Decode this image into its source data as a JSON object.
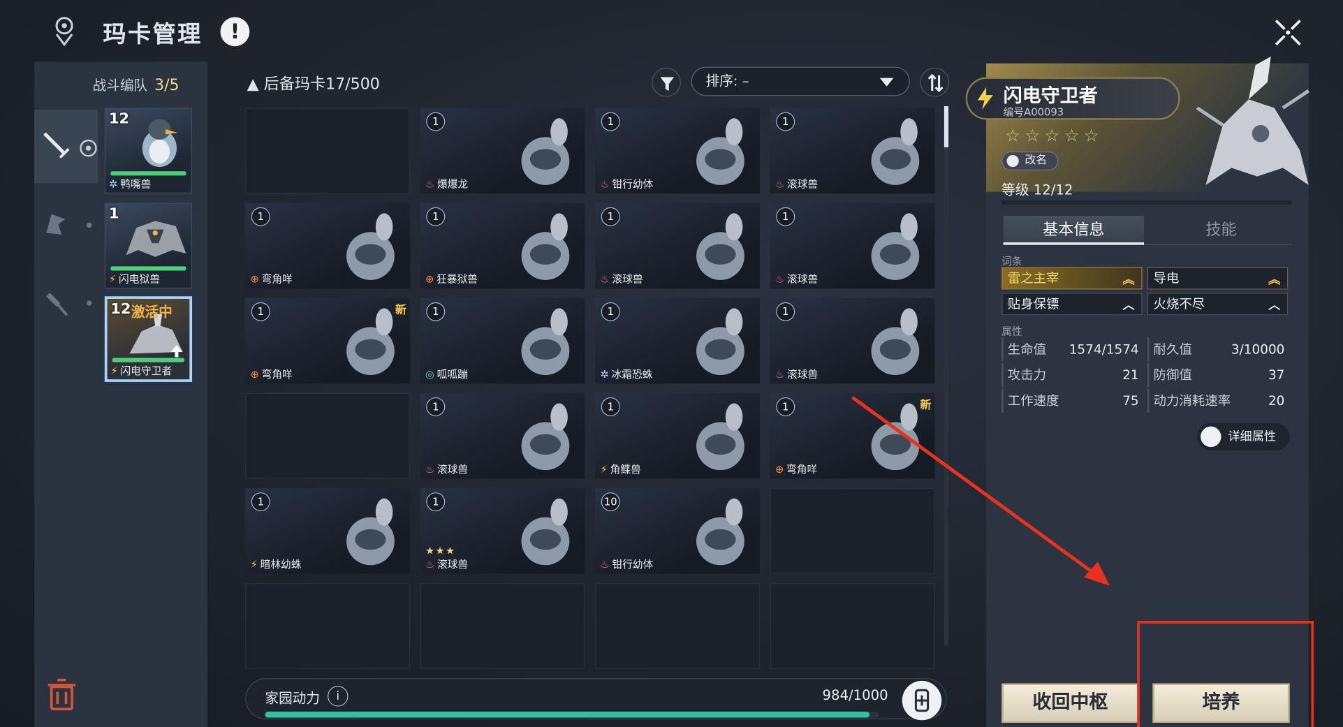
{
  "header": {
    "title": "玛卡管理",
    "alert": "!"
  },
  "team": {
    "label": "战斗编队",
    "count": "3/5",
    "members": [
      {
        "level": "12",
        "name": "鸭嘴兽",
        "element": "ice",
        "active": false
      },
      {
        "level": "1",
        "name": "闪电狱兽",
        "element": "elec",
        "active": false
      },
      {
        "level": "12",
        "name": "闪电守卫者",
        "element": "elec",
        "active": true,
        "tag": "激活中"
      }
    ]
  },
  "reserve": {
    "label": "后备玛卡17/500",
    "sort_label": "排序: –",
    "cards": [
      {
        "empty": true
      },
      {
        "level": "1",
        "name": "爆爆龙",
        "element": "fire"
      },
      {
        "level": "1",
        "name": "钳行幼体",
        "element": "fire"
      },
      {
        "level": "1",
        "name": "滚球兽",
        "element": "fire"
      },
      {
        "level": "1",
        "name": "弯角咩",
        "element": "earth"
      },
      {
        "level": "1",
        "name": "狂暴狱兽",
        "element": "earth"
      },
      {
        "level": "1",
        "name": "滚球兽",
        "element": "fire"
      },
      {
        "level": "1",
        "name": "滚球兽",
        "element": "fire"
      },
      {
        "level": "1",
        "name": "弯角咩",
        "element": "earth",
        "new": "新"
      },
      {
        "level": "1",
        "name": "呱呱蹦",
        "element": "wind"
      },
      {
        "level": "1",
        "name": "冰霜恐蛛",
        "element": "ice"
      },
      {
        "level": "1",
        "name": "滚球兽",
        "element": "fire"
      },
      {
        "empty": true
      },
      {
        "level": "1",
        "name": "滚球兽",
        "element": "fire"
      },
      {
        "level": "1",
        "name": "角鲽兽",
        "element": "elec"
      },
      {
        "level": "1",
        "name": "弯角咩",
        "element": "earth",
        "new": "新"
      },
      {
        "level": "1",
        "name": "暗林幼蛛",
        "element": "elec"
      },
      {
        "level": "1",
        "name": "滚球兽",
        "element": "fire",
        "stars": "★★★"
      },
      {
        "level": "10",
        "name": "钳行幼体",
        "element": "fire"
      },
      {
        "empty": true
      },
      {
        "empty": true
      },
      {
        "empty": true
      },
      {
        "empty": true
      },
      {
        "empty": true
      }
    ]
  },
  "energy": {
    "label": "家园动力",
    "value": "984/1000",
    "fraction": 0.984
  },
  "detail": {
    "name": "闪电守卫者",
    "id": "编号A00093",
    "stars": "☆☆☆☆☆",
    "rename": "改名",
    "level": "等级 12/12",
    "tabs": [
      "基本信息",
      "技能"
    ],
    "traits_label": "词条",
    "traits": [
      {
        "text": "雷之主宰",
        "style": "gold",
        "chev": "︽"
      },
      {
        "text": "导电",
        "style": "gold2",
        "chev": "︽"
      },
      {
        "text": "贴身保镖",
        "style": "plain",
        "chev": "︿"
      },
      {
        "text": "火烧不尽",
        "style": "plain",
        "chev": "︿"
      }
    ],
    "attrs_label": "属性",
    "attrs": [
      {
        "k": "生命值",
        "v": "1574/1574"
      },
      {
        "k": "耐久值",
        "v": "3/10000"
      },
      {
        "k": "攻击力",
        "v": "21"
      },
      {
        "k": "防御值",
        "v": "37"
      },
      {
        "k": "工作速度",
        "v": "75"
      },
      {
        "k": "动力消耗速率",
        "v": "20"
      }
    ],
    "more": "详细属性",
    "btn_recall": "收回中枢",
    "btn_train": "培养"
  },
  "colors": {
    "accent_gold": "#f3c54d",
    "energy": "#2fc1a0",
    "annotation_red": "#e8321d"
  }
}
